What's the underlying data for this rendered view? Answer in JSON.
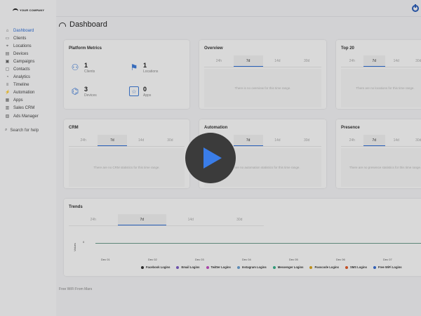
{
  "sidebar": {
    "logo_text": "YOUR COMPANY",
    "items": [
      {
        "label": "Dashboard",
        "icon": "home-icon",
        "glyph": "⌂"
      },
      {
        "label": "Clients",
        "icon": "id-card-icon",
        "glyph": "▭"
      },
      {
        "label": "Locations",
        "icon": "location-icon",
        "glyph": "⌖"
      },
      {
        "label": "Devices",
        "icon": "devices-icon",
        "glyph": "▤"
      },
      {
        "label": "Campaigns",
        "icon": "campaigns-icon",
        "glyph": "▣"
      },
      {
        "label": "Contacts",
        "icon": "contacts-icon",
        "glyph": "▢"
      },
      {
        "label": "Analytics",
        "icon": "analytics-icon",
        "glyph": "◔"
      },
      {
        "label": "Timeline",
        "icon": "timeline-icon",
        "glyph": "≡"
      },
      {
        "label": "Automation",
        "icon": "automation-icon",
        "glyph": "⚡"
      },
      {
        "label": "Apps",
        "icon": "apps-icon",
        "glyph": "▦"
      },
      {
        "label": "Sales CRM",
        "icon": "crm-icon",
        "glyph": "▥"
      },
      {
        "label": "Ads Manager",
        "icon": "ads-icon",
        "glyph": "▧"
      }
    ],
    "search_help": "Search for help"
  },
  "header": {
    "title": "Dashboard"
  },
  "tabs": [
    "24h",
    "7d",
    "14d",
    "30d"
  ],
  "platform_metrics": {
    "title": "Platform Metrics",
    "clients": {
      "value": "1",
      "label": "Clients"
    },
    "locations": {
      "value": "1",
      "label": "Locations"
    },
    "devices": {
      "value": "3",
      "label": "Devices"
    },
    "apps": {
      "value": "0",
      "label": "Apps"
    }
  },
  "overview": {
    "title": "Overview",
    "empty": "There is no overview for this time range."
  },
  "top20": {
    "title": "Top 20",
    "empty": "There are no locations for this time range."
  },
  "crm": {
    "title": "CRM",
    "empty": "There are no CRM statistics for this time range."
  },
  "automation": {
    "title": "Automation",
    "empty": "There are no automation statistics for this time range."
  },
  "presence": {
    "title": "Presence",
    "empty": "There are no presence statistics for this time range."
  },
  "trends": {
    "title": "Trends",
    "y_label": "Values",
    "y_tick": "0",
    "x_ticks": [
      "Dec 01",
      "Dec 02",
      "Dec 03",
      "Dec 04",
      "Dec 05",
      "Dec 06",
      "Dec 07"
    ],
    "legend": [
      {
        "label": "Facebook Logins",
        "color": "#333333"
      },
      {
        "label": "Email Logins",
        "color": "#7c5cc4"
      },
      {
        "label": "Twitter Logins",
        "color": "#c04fc0"
      },
      {
        "label": "Instagram Logins",
        "color": "#6aa0d0"
      },
      {
        "label": "Messenger Logins",
        "color": "#3ab08a"
      },
      {
        "label": "Passcode Logins",
        "color": "#d9a520"
      },
      {
        "label": "SMS Logins",
        "color": "#e05a2a"
      },
      {
        "label": "Free WiFi Logins",
        "color": "#3a6fd0"
      }
    ]
  },
  "footer": {
    "text": "Free WiFi From Mars"
  },
  "video": {
    "play_icon": "play-icon"
  }
}
